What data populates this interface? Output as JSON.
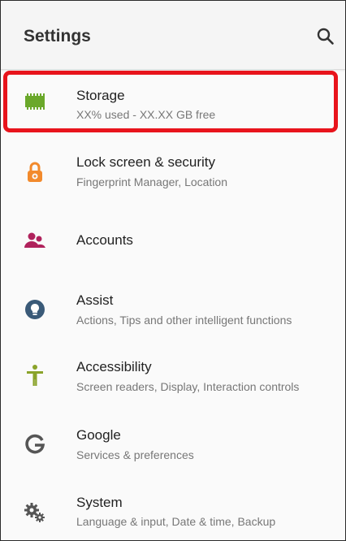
{
  "header": {
    "title": "Settings",
    "search_icon": "search-icon"
  },
  "colors": {
    "storage": "#6aa82a",
    "lock": "#f28a2c",
    "accounts": "#b0225c",
    "assist": "#3a5a78",
    "accessibility": "#8aa32a",
    "google": "#555555",
    "system": "#555555",
    "highlight": "#e8141c"
  },
  "items": [
    {
      "title": "Storage",
      "subtitle": "XX% used - XX.XX GB free",
      "icon": "storage-chip-icon",
      "highlighted": true
    },
    {
      "title": "Lock screen & security",
      "subtitle": "Fingerprint Manager, Location",
      "icon": "lock-icon"
    },
    {
      "title": "Accounts",
      "subtitle": "",
      "icon": "accounts-people-icon"
    },
    {
      "title": "Assist",
      "subtitle": "Actions, Tips and other intelligent functions",
      "icon": "lightbulb-icon"
    },
    {
      "title": "Accessibility",
      "subtitle": "Screen readers, Display, Interaction controls",
      "icon": "accessibility-person-icon"
    },
    {
      "title": "Google",
      "subtitle": "Services & preferences",
      "icon": "google-g-icon"
    },
    {
      "title": "System",
      "subtitle": "Language & input, Date & time, Backup",
      "icon": "system-gears-icon"
    }
  ]
}
